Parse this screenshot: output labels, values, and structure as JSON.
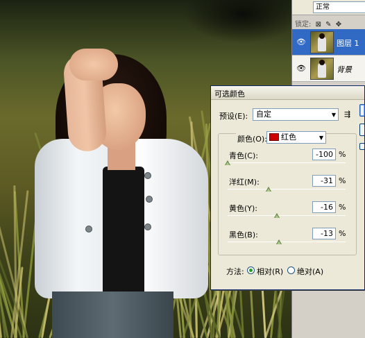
{
  "layers_panel": {
    "blend_mode": "正常",
    "lock_label": "锁定:",
    "layers": [
      {
        "name": "图层 1",
        "selected": true,
        "visible": true
      },
      {
        "name": "背景",
        "selected": false,
        "visible": true
      }
    ]
  },
  "dialog": {
    "title": "可选颜色",
    "preset_label": "预设(E):",
    "preset_value": "自定",
    "colors_label": "颜色(O):",
    "colors_value": "红色",
    "colors_swatch": "#cc0000",
    "sliders": [
      {
        "label": "青色(C):",
        "value": "-100",
        "unit": "%",
        "level": -100
      },
      {
        "label": "洋红(M):",
        "value": "-31",
        "unit": "%",
        "level": -31
      },
      {
        "label": "黄色(Y):",
        "value": "-16",
        "unit": "%",
        "level": -16
      },
      {
        "label": "黑色(B):",
        "value": "-13",
        "unit": "%",
        "level": -13
      }
    ],
    "method_label": "方法:",
    "method_relative": "相对(R)",
    "method_absolute": "绝对(A)",
    "method_selected": "relative"
  }
}
